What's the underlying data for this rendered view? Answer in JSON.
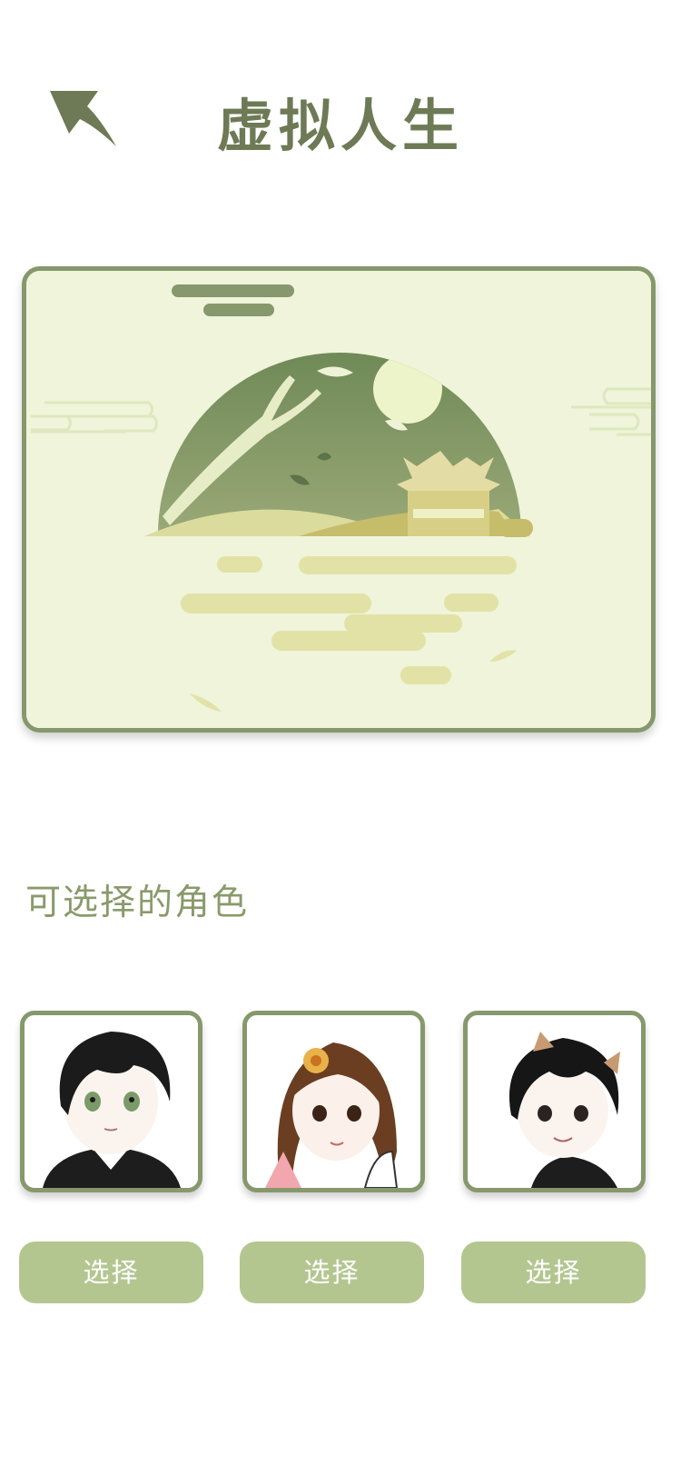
{
  "header": {
    "title": "虚拟人生",
    "back_icon": "back-arrow-icon"
  },
  "banner": {
    "image_name": "landscape-illustration"
  },
  "characters_section": {
    "title": "可选择的角色"
  },
  "characters": [
    {
      "avatar": "boy-green-eyes-avatar",
      "select_label": "选择"
    },
    {
      "avatar": "girl-hairpin-avatar",
      "select_label": "选择"
    },
    {
      "avatar": "boy-cat-ears-avatar",
      "select_label": "选择"
    }
  ],
  "colors": {
    "accent": "#86986c",
    "title": "#6d7a55",
    "button": "#b3c690",
    "banner_bg": "#eff4da"
  }
}
